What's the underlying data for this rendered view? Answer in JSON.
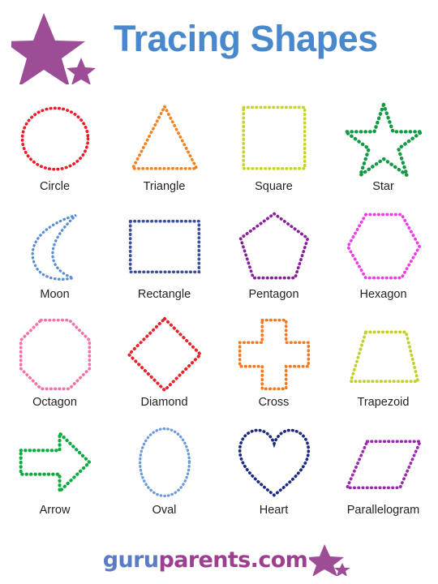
{
  "header": {
    "title": "Tracing Shapes",
    "logo_icon": "two-stars-icon",
    "logo_color": "#9c4d96",
    "title_color": "#4a88ce"
  },
  "shapes": [
    {
      "label": "Circle",
      "icon": "circle-shape",
      "color": "#ee1c25"
    },
    {
      "label": "Triangle",
      "icon": "triangle-shape",
      "color": "#f58220"
    },
    {
      "label": "Square",
      "icon": "square-shape",
      "color": "#c8d420"
    },
    {
      "label": "Star",
      "icon": "star-shape",
      "color": "#119944"
    },
    {
      "label": "Moon",
      "icon": "crescent-moon-shape",
      "color": "#5b8fd4"
    },
    {
      "label": "Rectangle",
      "icon": "rectangle-shape",
      "color": "#3b4fa0"
    },
    {
      "label": "Pentagon",
      "icon": "pentagon-shape",
      "color": "#8a1f9e"
    },
    {
      "label": "Hexagon",
      "icon": "hexagon-shape",
      "color": "#f23ce8"
    },
    {
      "label": "Octagon",
      "icon": "octagon-shape",
      "color": "#f472ab"
    },
    {
      "label": "Diamond",
      "icon": "diamond-shape",
      "color": "#e8232a"
    },
    {
      "label": "Cross",
      "icon": "cross-shape",
      "color": "#f57920"
    },
    {
      "label": "Trapezoid",
      "icon": "trapezoid-shape",
      "color": "#c3d028"
    },
    {
      "label": "Arrow",
      "icon": "arrow-right-shape",
      "color": "#0eaa3f"
    },
    {
      "label": "Oval",
      "icon": "oval-shape",
      "color": "#6b9bdd"
    },
    {
      "label": "Heart",
      "icon": "heart-shape",
      "color": "#1c2a80"
    },
    {
      "label": "Parallelogram",
      "icon": "parallelogram-shape",
      "color": "#9c27b0"
    }
  ],
  "footer": {
    "brand_part1": "guru",
    "brand_part2": "parents.com",
    "brand_part1_color": "#5b7cc4",
    "brand_part2_color": "#9c3f8f",
    "stars_icon": "two-stars-icon",
    "stars_color": "#9c4d96"
  }
}
